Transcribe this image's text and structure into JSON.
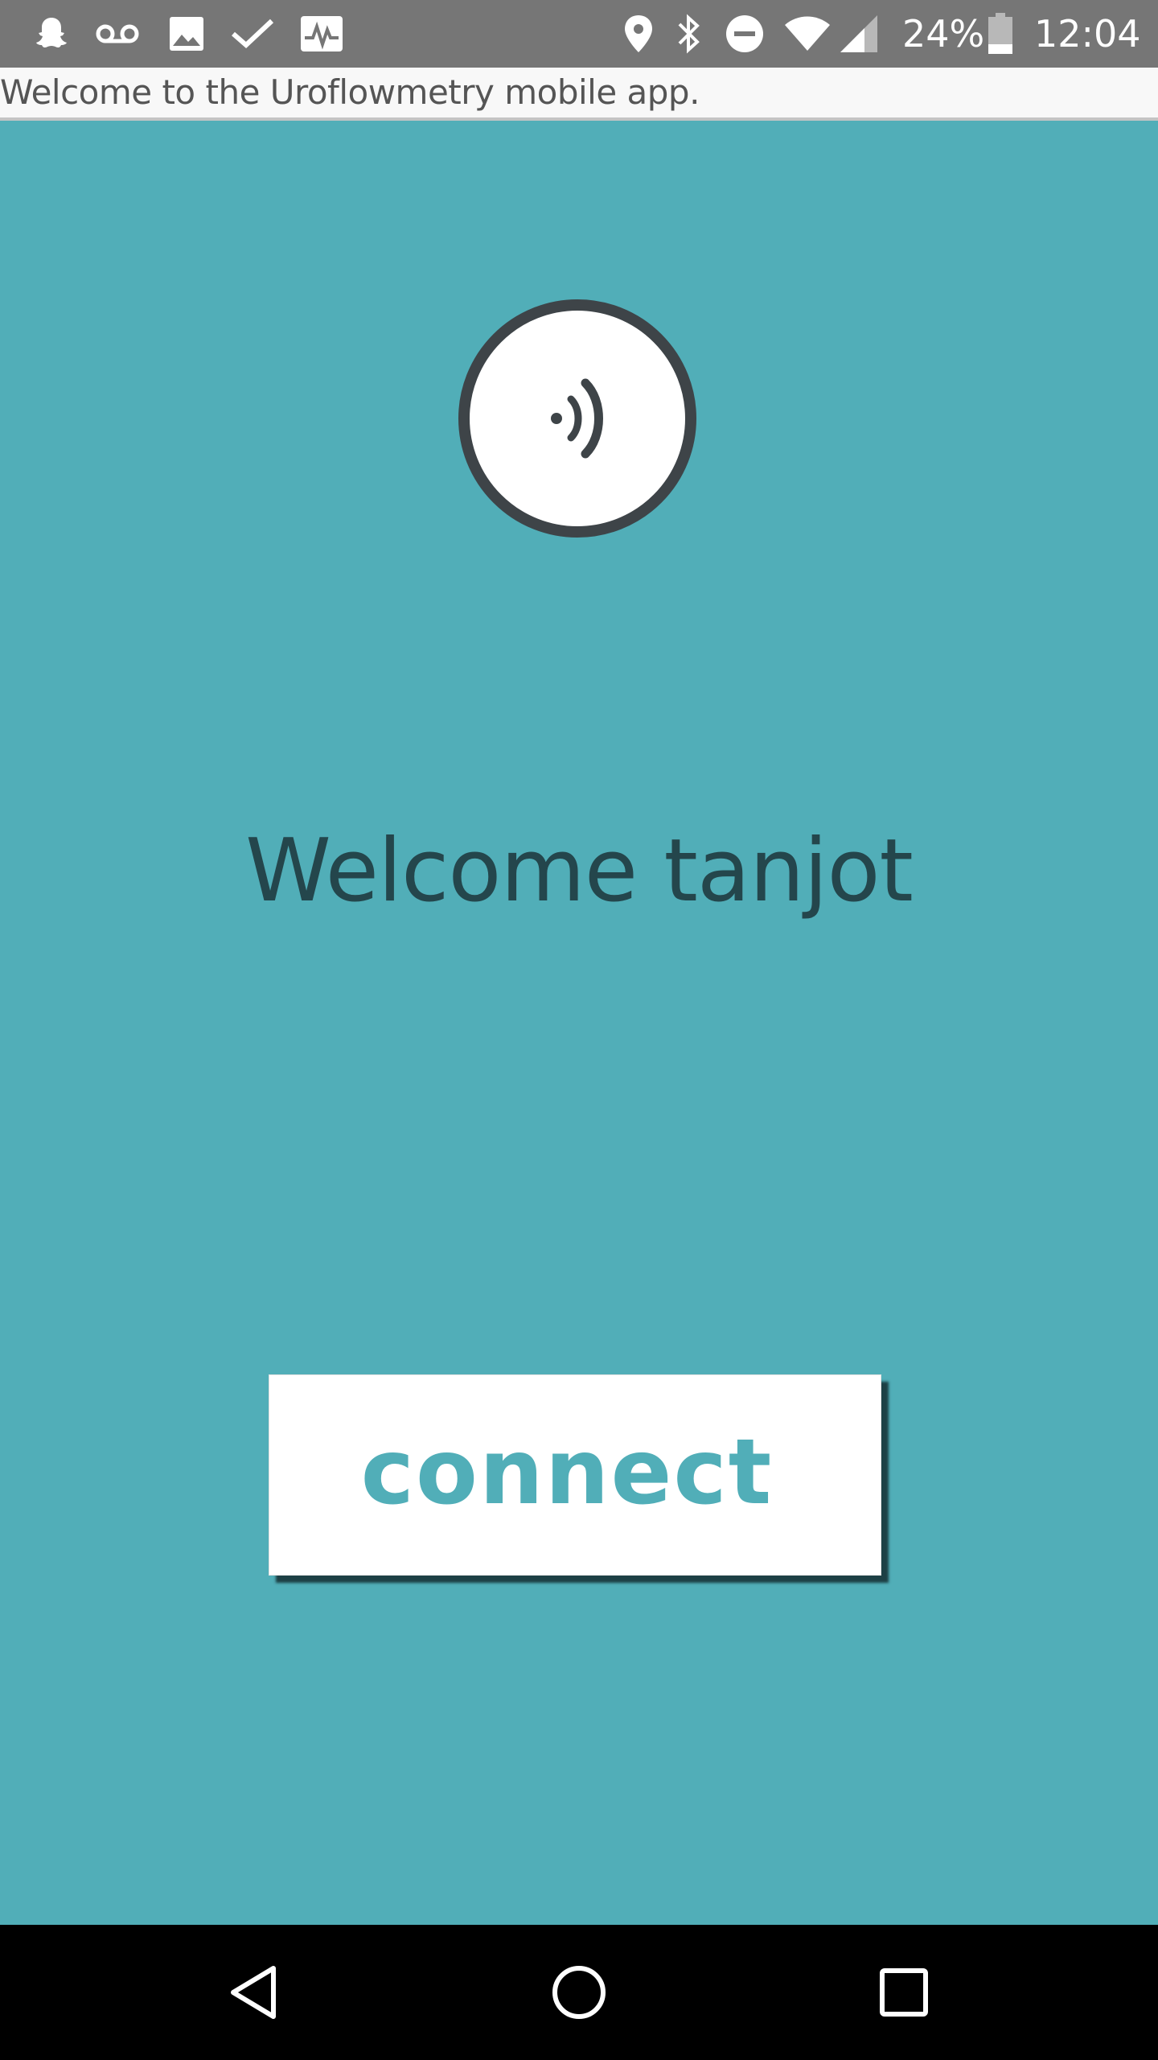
{
  "status_bar": {
    "icons_left": [
      "snapchat-icon",
      "voicemail-icon",
      "image-icon",
      "check-icon",
      "activity-icon"
    ],
    "icons_right": [
      "location-icon",
      "bluetooth-icon",
      "do-not-disturb-icon",
      "wifi-icon",
      "cell-signal-icon",
      "battery-icon"
    ],
    "battery_percent": "24%",
    "time": "12:04"
  },
  "notice": {
    "text": "Welcome to the Uroflowmetry mobile app."
  },
  "main": {
    "welcome_text": "Welcome tanjot",
    "connect_label": "connect"
  },
  "nav_bar": {
    "buttons": [
      "back",
      "home",
      "recents"
    ]
  },
  "colors": {
    "background": "#51aeb8",
    "status_bar": "#767676",
    "welcome_text": "#24464c",
    "connect_text": "#51aeb8"
  }
}
